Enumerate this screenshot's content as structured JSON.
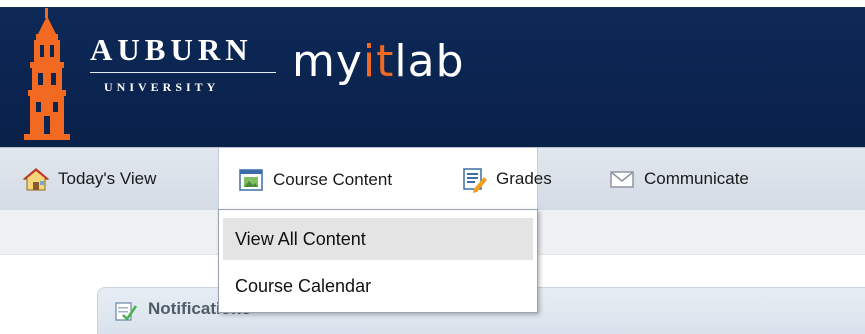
{
  "header": {
    "university_name": "AUBURN",
    "university_sub": "UNIVERSITY",
    "product_pre": "my",
    "product_it": "it",
    "product_post": "lab"
  },
  "nav": {
    "items": [
      {
        "label": "Today's View",
        "icon": "house-icon"
      },
      {
        "label": "Course Content",
        "icon": "course-window-icon"
      },
      {
        "label": "Grades",
        "icon": "gradebook-icon"
      },
      {
        "label": "Communicate",
        "icon": "envelope-icon"
      }
    ]
  },
  "dropdown": {
    "items": [
      {
        "label": "View All Content"
      },
      {
        "label": "Course Calendar"
      }
    ]
  },
  "panel": {
    "notifications_label": "Notifications"
  },
  "colors": {
    "brand_navy": "#0b2450",
    "brand_orange": "#f26a21"
  }
}
